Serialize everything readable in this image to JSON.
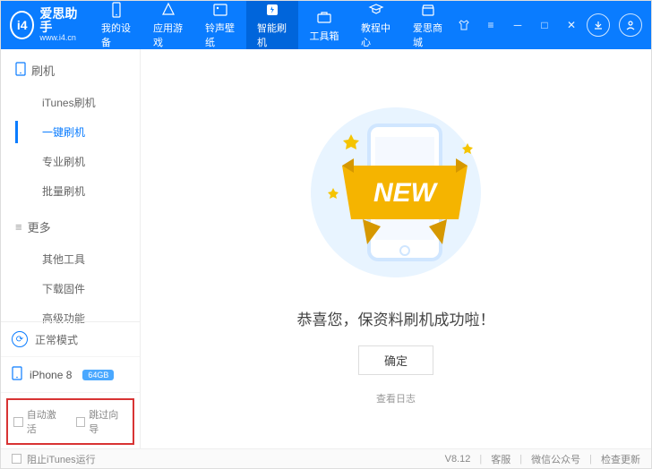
{
  "header": {
    "logo_main": "爱思助手",
    "logo_sub": "www.i4.cn",
    "nav": [
      {
        "label": "我的设备"
      },
      {
        "label": "应用游戏"
      },
      {
        "label": "铃声壁纸"
      },
      {
        "label": "智能刷机"
      },
      {
        "label": "工具箱"
      },
      {
        "label": "教程中心"
      },
      {
        "label": "爱思商城"
      }
    ]
  },
  "sidebar": {
    "section1_title": "刷机",
    "section1_items": [
      "iTunes刷机",
      "一键刷机",
      "专业刷机",
      "批量刷机"
    ],
    "section2_title": "更多",
    "section2_items": [
      "其他工具",
      "下载固件",
      "高级功能"
    ],
    "mode_text": "正常模式",
    "device_name": "iPhone 8",
    "device_badge": "64GB",
    "autoactivate": "自动激活",
    "skipguide": "跳过向导"
  },
  "main": {
    "new_tag": "NEW",
    "success_title": "恭喜您，保资料刷机成功啦！",
    "confirm": "确定",
    "view_log": "查看日志"
  },
  "footer": {
    "blockitunes": "阻止iTunes运行",
    "version": "V8.12",
    "service": "客服",
    "wechat": "微信公众号",
    "checkupdate": "检查更新"
  }
}
